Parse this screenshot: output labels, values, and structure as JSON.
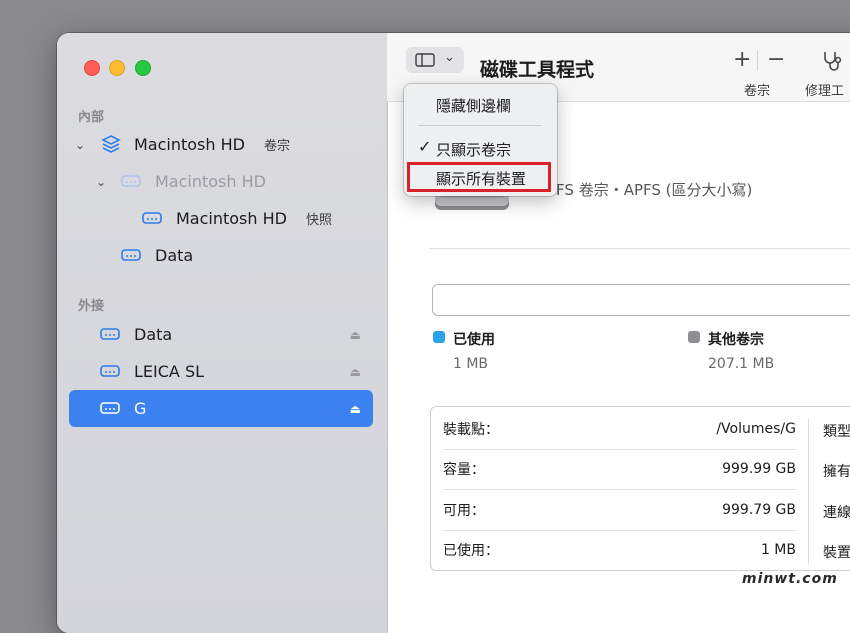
{
  "sidebar": {
    "internal_label": "內部",
    "external_label": "外接",
    "internal": [
      {
        "label": "Macintosh HD",
        "sub": "卷宗"
      },
      {
        "label": "Macintosh HD",
        "sub": ""
      },
      {
        "label": "Macintosh HD",
        "sub": "快照"
      },
      {
        "label": "Data",
        "sub": ""
      }
    ],
    "external": [
      {
        "label": "Data"
      },
      {
        "label": "LEICA SL"
      },
      {
        "label": "G"
      }
    ]
  },
  "toolbar": {
    "title": "磁碟工具程式",
    "add_label": "+",
    "remove_label": "−",
    "volume_label": "卷宗",
    "repair_label": "修理工"
  },
  "menu": {
    "hide_sidebar": "隱藏側邊欄",
    "show_volumes_only": "只顯示卷宗",
    "show_all_devices": "顯示所有裝置",
    "checkmark": "✓"
  },
  "volume": {
    "name_partial": "G",
    "description": "PFS 卷宗・APFS (區分大小寫)"
  },
  "usage": {
    "used_label": "已使用",
    "used_value": "1 MB",
    "used_color": "#2aa3e8",
    "other_label": "其他卷宗",
    "other_value": "207.1 MB",
    "other_color": "#8e8e93"
  },
  "info": {
    "rows": [
      {
        "label": "裝載點：",
        "value": "/Volumes/G"
      },
      {
        "label": "容量：",
        "value": "999.99 GB"
      },
      {
        "label": "可用：",
        "value": "999.79 GB"
      },
      {
        "label": "已使用：",
        "value": "1 MB"
      }
    ],
    "col2": [
      "類型",
      "擁有",
      "連線",
      "裝置"
    ]
  },
  "watermark": "minwt.com"
}
